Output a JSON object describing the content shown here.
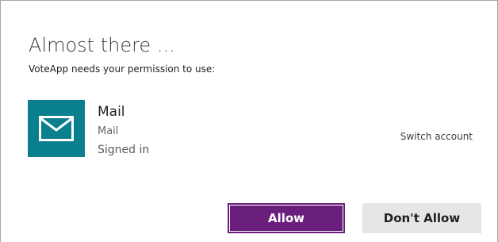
{
  "dialog": {
    "title": "Almost there ...",
    "subtitle": "VoteApp needs your permission to use:"
  },
  "service": {
    "name": "Mail",
    "subname": "Mail",
    "status": "Signed in",
    "icon": "mail-icon",
    "tile_color": "#0a7f8e"
  },
  "actions": {
    "switch_account": "Switch account",
    "allow_label": "Allow",
    "deny_label": "Don't Allow"
  },
  "colors": {
    "allow_button": "#6b1f7c",
    "deny_button": "#e6e6e6"
  }
}
